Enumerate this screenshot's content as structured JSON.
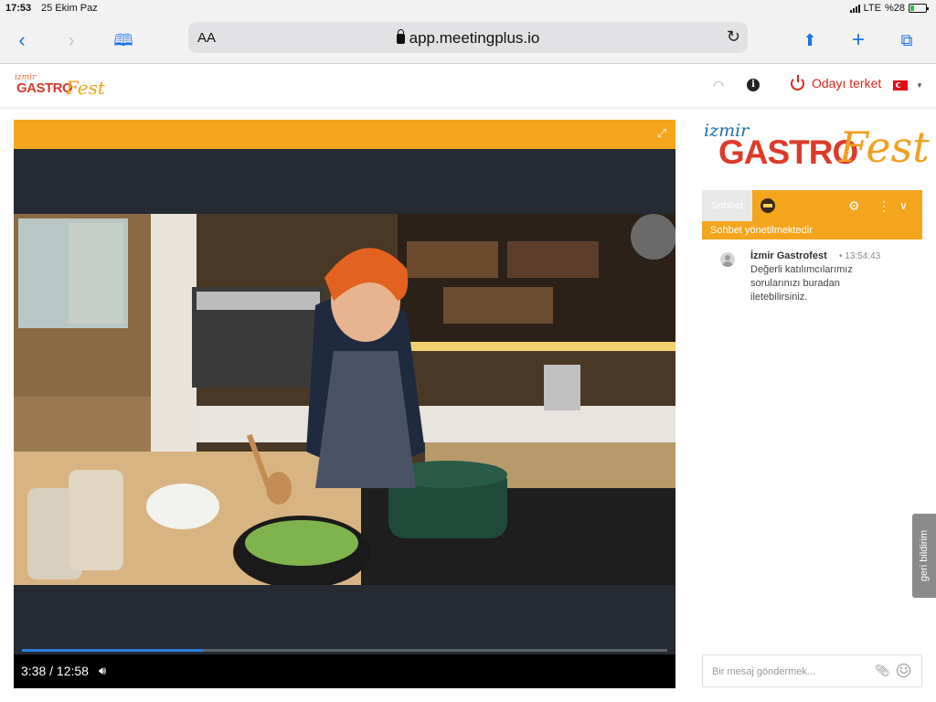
{
  "status_bar": {
    "time": "17:53",
    "date": "25 Ekim Paz",
    "network": "LTE",
    "battery": "%28",
    "battery_level": 0.28
  },
  "browser": {
    "aa_label": "AA",
    "url": "app.meetingplus.io"
  },
  "header": {
    "logo": {
      "izmir": "izmir",
      "gastro": "GASTRO",
      "fest": "Fest"
    },
    "leave_label": "Odayı terket",
    "colors": {
      "brand_orange": "#f4a51e",
      "leave_red": "#d9261c"
    }
  },
  "player": {
    "current_time": "3:38",
    "duration": "12:58",
    "time_display": "3:38 / 12:58",
    "progress": 0.28
  },
  "sidebar": {
    "logo": {
      "izmir": "izmir",
      "gastro": "GASTRO",
      "fest": "Fest"
    },
    "chat_tab_label": "Sohbet",
    "moderation_note": "Sohbet yönetilmektedir",
    "messages": [
      {
        "author": "İzmir Gastrofest",
        "timestamp": "13:54:43",
        "text": "Değerli katılımcılarımız sorularınızı buradan iletebilirsiniz."
      }
    ],
    "feedback_label": "geri bildirim",
    "input_placeholder": "Bir mesaj göndermek..."
  }
}
